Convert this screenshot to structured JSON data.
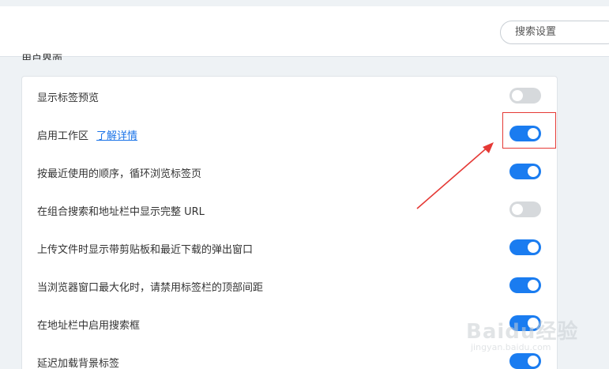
{
  "header": {
    "search_placeholder": "搜索设置"
  },
  "section": {
    "title": "用户界面"
  },
  "settings": [
    {
      "label": "显示标签预览",
      "enabled": false
    },
    {
      "label": "启用工作区",
      "link": "了解详情",
      "enabled": true
    },
    {
      "label": "按最近使用的顺序，循环浏览标签页",
      "enabled": true
    },
    {
      "label": "在组合搜索和地址栏中显示完整 URL",
      "enabled": false
    },
    {
      "label": "上传文件时显示带剪贴板和最近下载的弹出窗口",
      "enabled": true
    },
    {
      "label": "当浏览器窗口最大化时，请禁用标签栏的顶部间距",
      "enabled": true
    },
    {
      "label": "在地址栏中启用搜索框",
      "enabled": true
    },
    {
      "label": "延迟加载背景标签",
      "enabled": true
    }
  ],
  "colors": {
    "toggle_on": "#1a7cf0",
    "toggle_off": "#d6d9dc",
    "annotation": "#e53935",
    "link": "#1a73e8"
  },
  "watermark": {
    "main": "Baidu经验",
    "sub": "jingyan.baidu.com"
  }
}
